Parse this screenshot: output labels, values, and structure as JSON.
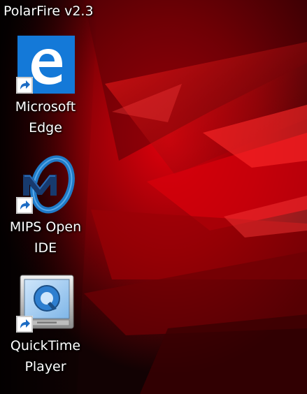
{
  "desktop": {
    "top_label": "PolarFire v2.3",
    "shortcuts": [
      {
        "label": "Microsoft\nEdge",
        "icon": "edge-icon"
      },
      {
        "label": "MIPS Open\nIDE",
        "icon": "mips-icon"
      },
      {
        "label": "QuickTime\nPlayer",
        "icon": "quicktime-icon"
      }
    ]
  },
  "colors": {
    "wallpaper_dark": "#0a0203",
    "wallpaper_red": "#c8000a",
    "edge_blue": "#1479d8",
    "mips_blue": "#1f7ac7",
    "mips_dark": "#173a6e"
  }
}
